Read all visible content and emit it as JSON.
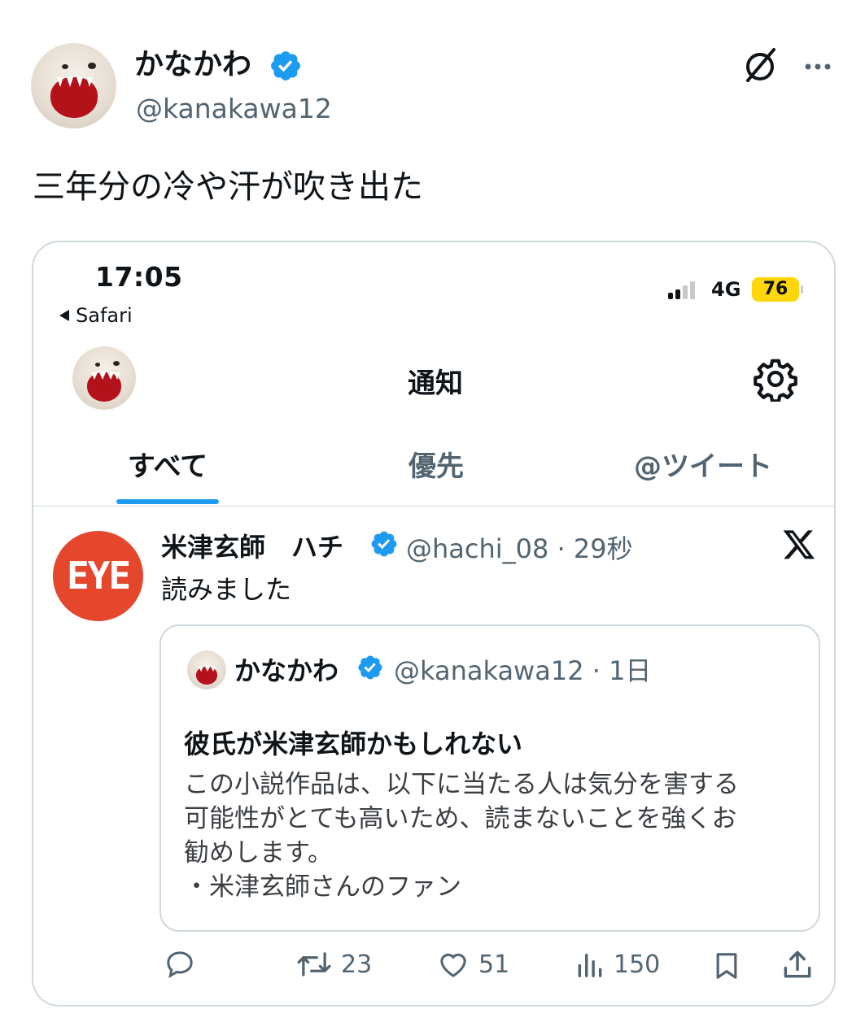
{
  "post": {
    "author_name": "かなかわ",
    "author_handle": "@kanakawa12",
    "text": "三年分の冷や汗が吹き出た"
  },
  "screenshot": {
    "status_bar": {
      "time": "17:05",
      "back_label": "Safari",
      "network": "4G",
      "battery": "76"
    },
    "header_title": "通知",
    "tabs": [
      {
        "label": "すべて",
        "active": true
      },
      {
        "label": "優先",
        "active": false
      },
      {
        "label": "@ツイート",
        "active": false
      }
    ],
    "notification": {
      "avatar_text": "EYE",
      "name": "米津玄師　ハチ",
      "meta": "@hachi_08 · 29秒",
      "text": "読みました",
      "quote": {
        "name": "かなかわ",
        "meta": "@kanakawa12 · 1日",
        "title": "彼氏が米津玄師かもしれない",
        "body_lines": [
          "この小説作品は、以下に当たる人は気分を害する",
          "可能性がとても高いため、読まないことを強くお",
          "勧めします。",
          "・米津玄師さんのファン"
        ]
      },
      "actions": {
        "retweets": "23",
        "likes": "51",
        "views": "150"
      }
    }
  },
  "colors": {
    "accent": "#1d9bf0",
    "battery": "#ffd60a",
    "eye_avatar": "#e4472c"
  },
  "icons": [
    "verified-badge-icon",
    "grok-icon",
    "more-icon",
    "gear-icon",
    "x-logo-icon",
    "reply-icon",
    "retweet-icon",
    "like-icon",
    "views-icon",
    "bookmark-icon",
    "share-icon"
  ]
}
